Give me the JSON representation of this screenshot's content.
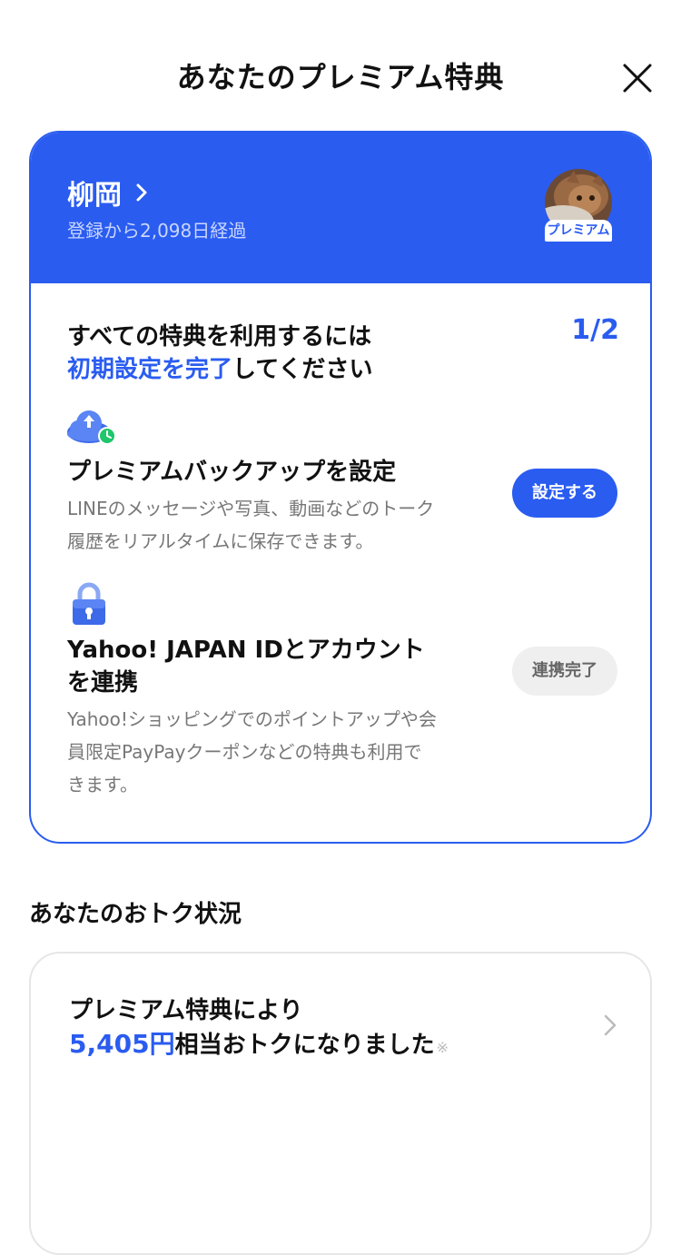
{
  "header": {
    "title": "あなたのプレミアム特典"
  },
  "profile": {
    "name": "柳岡",
    "days_label": "登録から2,098日経過",
    "badge": "プレミアム"
  },
  "setup": {
    "line1": "すべての特典を利用するには",
    "line2_accent": "初期設定を完了",
    "line2_rest": "してください",
    "progress": "1/2"
  },
  "items": [
    {
      "title": "プレミアムバックアップを設定",
      "desc_line1": "LINEのメッセージや写真、動画などのトーク",
      "desc_line2": "履歴をリアルタイムに保存できます。",
      "button": "設定する"
    },
    {
      "title_line1": "Yahoo! JAPAN IDとアカウント",
      "title_line2": "を連携",
      "desc_line1": "Yahoo!ショッピングでのポイントアップや会",
      "desc_line2": "員限定PayPayクーポンなどの特典も利用で",
      "desc_line3": "きます。",
      "button": "連携完了"
    }
  ],
  "savings": {
    "section_title": "あなたのおトク状況",
    "line1": "プレミアム特典により",
    "amount": "5,405円",
    "rest": "相当おトクになりました",
    "note": "※"
  },
  "colors": {
    "accent": "#2a5cf0",
    "desc_gray": "#777777",
    "pill_gray": "#efefef"
  },
  "icons": [
    "close-icon",
    "chevron-right-icon",
    "cloud-upload-icon",
    "padlock-icon"
  ]
}
